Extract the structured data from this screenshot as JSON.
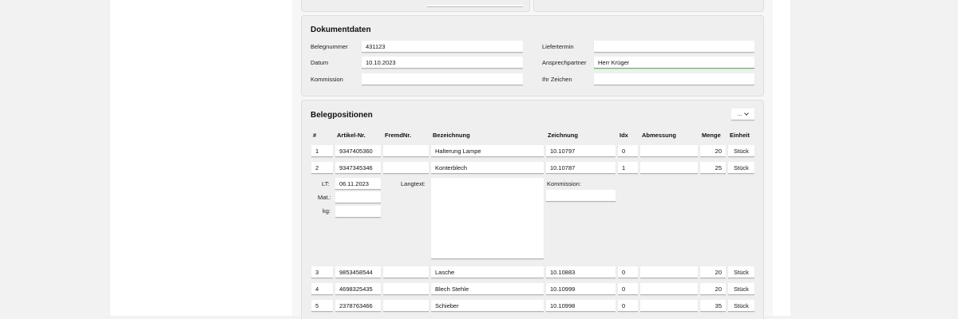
{
  "document": {
    "title": "Dokumentdaten",
    "fields": {
      "belegnummer": {
        "label": "Belegnummer",
        "value": "431123"
      },
      "datum": {
        "label": "Datum",
        "value": "10.10.2023"
      },
      "kommission": {
        "label": "Kommission",
        "value": ""
      },
      "liefertermin": {
        "label": "Liefertermin",
        "value": ""
      },
      "ansprechpartner": {
        "label": "Ansprechpartner",
        "value": "Herr Krüger"
      },
      "ihr_zeichen": {
        "label": "Ihr Zeichen",
        "value": ""
      }
    }
  },
  "positions": {
    "title": "Belegpositionen",
    "menu_label": "...",
    "columns": [
      "#",
      "Artikel-Nr.",
      "FremdNr.",
      "Bezeichnung",
      "Zeichnung",
      "Idx",
      "Abmessung",
      "Menge",
      "Einheit"
    ],
    "rows": [
      {
        "no": "1",
        "artikel": "9347405360",
        "fremd": "",
        "bezeichnung": "Halterung Lampe",
        "zeichnung": "10.10797",
        "idx": "0",
        "abmessung": "",
        "menge": "20",
        "einheit": "Stück"
      },
      {
        "no": "2",
        "artikel": "9347345346",
        "fremd": "",
        "bezeichnung": "Konterblech",
        "zeichnung": "10.10787",
        "idx": "1",
        "abmessung": "",
        "menge": "25",
        "einheit": "Stück"
      },
      {
        "no": "3",
        "artikel": "9853458544",
        "fremd": "",
        "bezeichnung": "Lasche",
        "zeichnung": "10.10883",
        "idx": "0",
        "abmessung": "",
        "menge": "20",
        "einheit": "Stück"
      },
      {
        "no": "4",
        "artikel": "4698325435",
        "fremd": "",
        "bezeichnung": "Blech Stehle",
        "zeichnung": "10.10999",
        "idx": "0",
        "abmessung": "",
        "menge": "20",
        "einheit": "Stück"
      },
      {
        "no": "5",
        "artikel": "2378763466",
        "fremd": "",
        "bezeichnung": "Schieber",
        "zeichnung": "10.10998",
        "idx": "0",
        "abmessung": "",
        "menge": "35",
        "einheit": "Stück"
      }
    ],
    "detail": {
      "lt_label": "LT:",
      "lt_value": "06.11.2023",
      "mat_label": "Mat.:",
      "mat_value": "",
      "kg_label": "kg:",
      "kg_value": "",
      "langtext_label": "Langtext:",
      "langtext_value": "",
      "kommission_label": "Kommission:",
      "kommission_value": ""
    }
  },
  "icons": {
    "menu_chevron": "chevron-down-icon"
  }
}
